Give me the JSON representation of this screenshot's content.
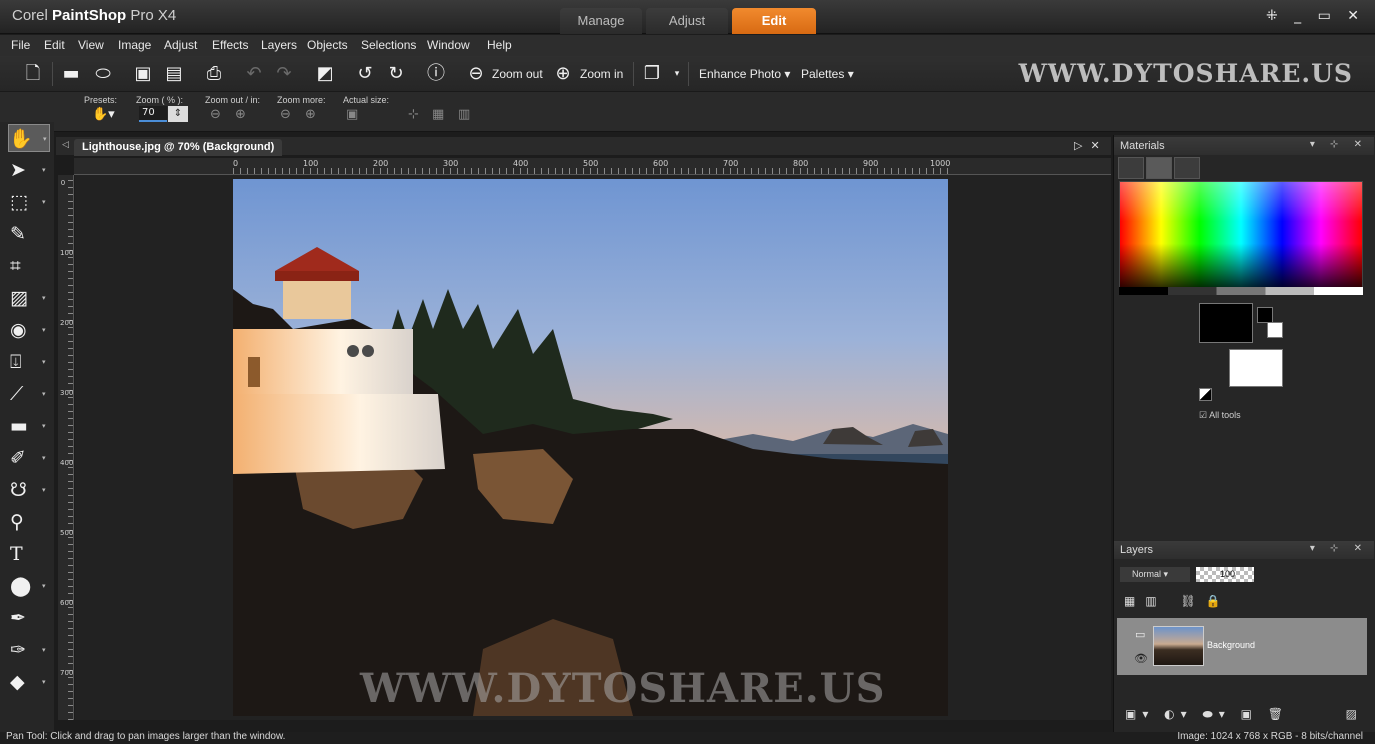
{
  "app": {
    "brand_light": "Corel",
    "brand_bold": "PaintShop",
    "brand_suffix": "Pro X4"
  },
  "mode_tabs": [
    {
      "label": "Manage",
      "active": false
    },
    {
      "label": "Adjust",
      "active": false
    },
    {
      "label": "Edit",
      "active": true
    }
  ],
  "window_controls": "⁜ _ ▭ ✕",
  "menu": [
    "File",
    "Edit",
    "View",
    "Image",
    "Adjust",
    "Effects",
    "Layers",
    "Objects",
    "Selections",
    "Window",
    "Help"
  ],
  "toolbar": {
    "zoom_out_label": "Zoom out",
    "zoom_in_label": "Zoom in",
    "enhance_label": "Enhance Photo ▾",
    "palettes_label": "Palettes ▾",
    "watermark": "WWW.DYTOSHARE.US"
  },
  "options": {
    "presets_label": "Presets:",
    "zoom_label": "Zoom ( % ):",
    "zoom_value": "70",
    "zoom_out_in_label": "Zoom out / in:",
    "zoom_more_label": "Zoom more:",
    "actual_size_label": "Actual size:"
  },
  "document": {
    "tab_title": "Lighthouse.jpg @  70% (Background)",
    "watermark": "WWW.DYTOSHARE.US",
    "ruler_labels": [
      "0",
      "100",
      "200",
      "300",
      "400",
      "500",
      "600",
      "700",
      "800",
      "900",
      "1000"
    ],
    "ruler_v_labels": [
      "0",
      "100",
      "200",
      "300",
      "400",
      "500",
      "600",
      "700"
    ]
  },
  "materials": {
    "title": "Materials",
    "all_tools_label": "All tools"
  },
  "layers": {
    "title": "Layers",
    "blend_mode": "Normal",
    "opacity": "100",
    "layer_name": "Background"
  },
  "status": {
    "left": "Pan Tool: Click and drag to pan images larger than the window.",
    "right": "Image:  1024 x 768 x RGB - 8 bits/channel"
  },
  "colors": {
    "accent": "#e27a1c",
    "foreground": "#000000",
    "background": "#ffffff"
  }
}
